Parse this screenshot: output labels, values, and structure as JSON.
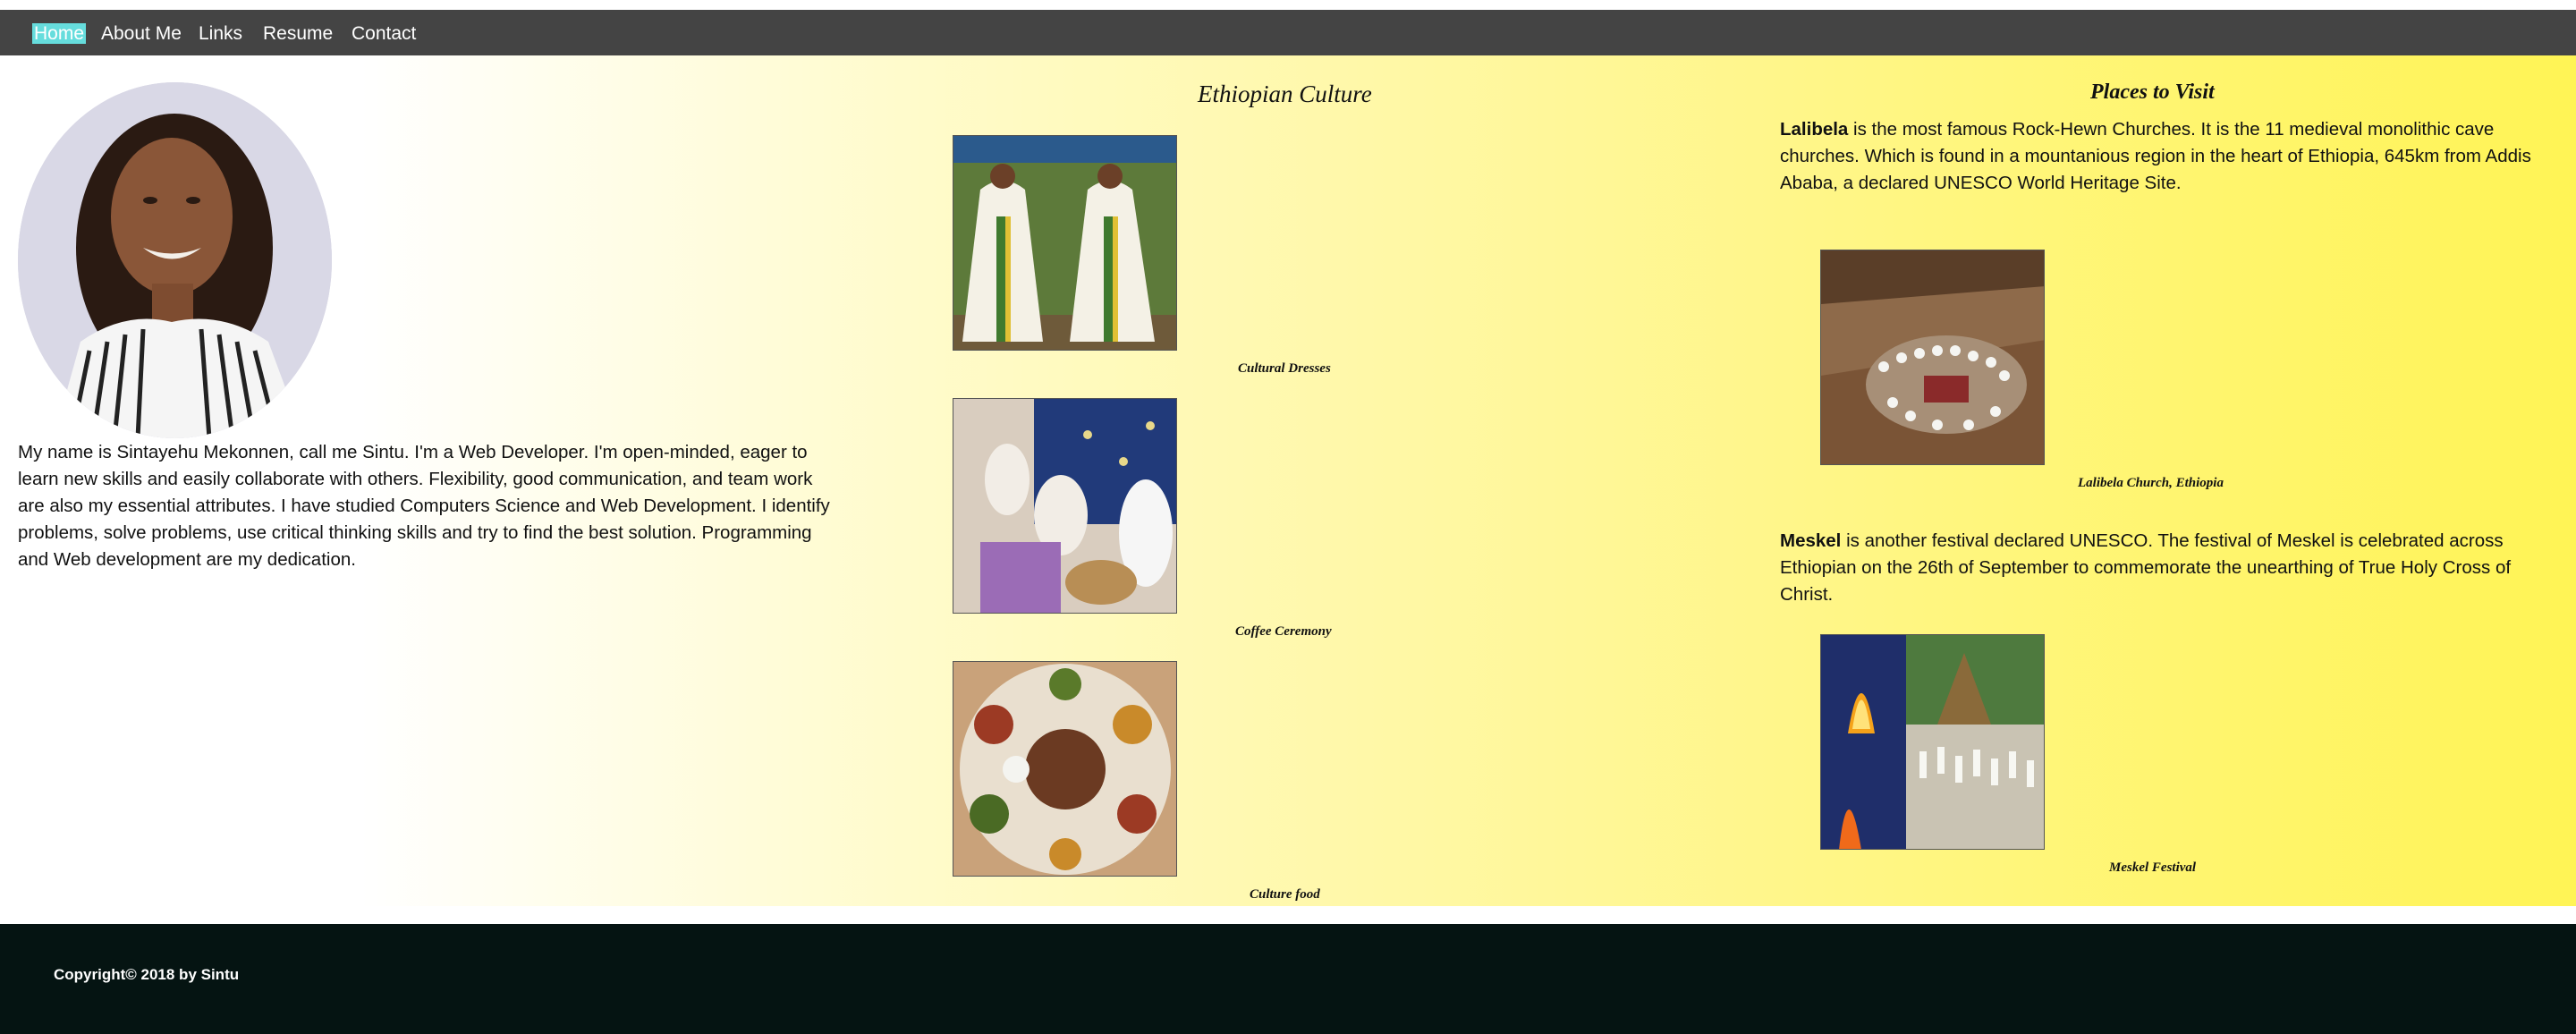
{
  "nav": {
    "items": [
      {
        "label": "Home",
        "active": true
      },
      {
        "label": "About Me"
      },
      {
        "label": "Links"
      },
      {
        "label": "Resume"
      },
      {
        "label": "Contact"
      }
    ]
  },
  "profile": {
    "photo_icon": "portrait-photo",
    "bio": "My name is Sintayehu Mekonnen, call me Sintu. I'm a Web Developer. I'm open-minded, eager to learn new skills and easily collaborate with others. Flexibility, good communication, and team work are also my essential attributes. I have studied Computers Science and Web Development. I identify problems, solve problems, use critical thinking skills and try to find the best solution. Programming and Web development are my dedication."
  },
  "culture": {
    "title": "Ethiopian Culture",
    "items": [
      {
        "caption": "Cultural Dresses"
      },
      {
        "caption": "Coffee Ceremony"
      },
      {
        "caption": "Culture food"
      }
    ]
  },
  "places": {
    "title": "Places to Visit",
    "lalibela": {
      "name": "Lalibela",
      "text": " is the most famous Rock-Hewn Churches. It is the 11 medieval monolithic cave churches. Which is found in a mountanious region in the heart of Ethiopia, 645km from Addis Ababa, a declared UNESCO World Heritage Site.",
      "caption": "Lalibela Church, Ethiopia"
    },
    "meskel": {
      "name": "Meskel",
      "text": " is another festival declared UNESCO. The festival of Meskel is celebrated across Ethiopian on the 26th of September to commemorate the unearthing of True Holy Cross of Christ.",
      "caption": "Meskel Festival"
    }
  },
  "footer": {
    "copyright": "Copyright© 2018 by Sintu"
  },
  "colors": {
    "nav_bg": "#444444",
    "active_bg": "#66dddd",
    "footer_bg": "#051412",
    "gradient_end": "#fff455"
  }
}
